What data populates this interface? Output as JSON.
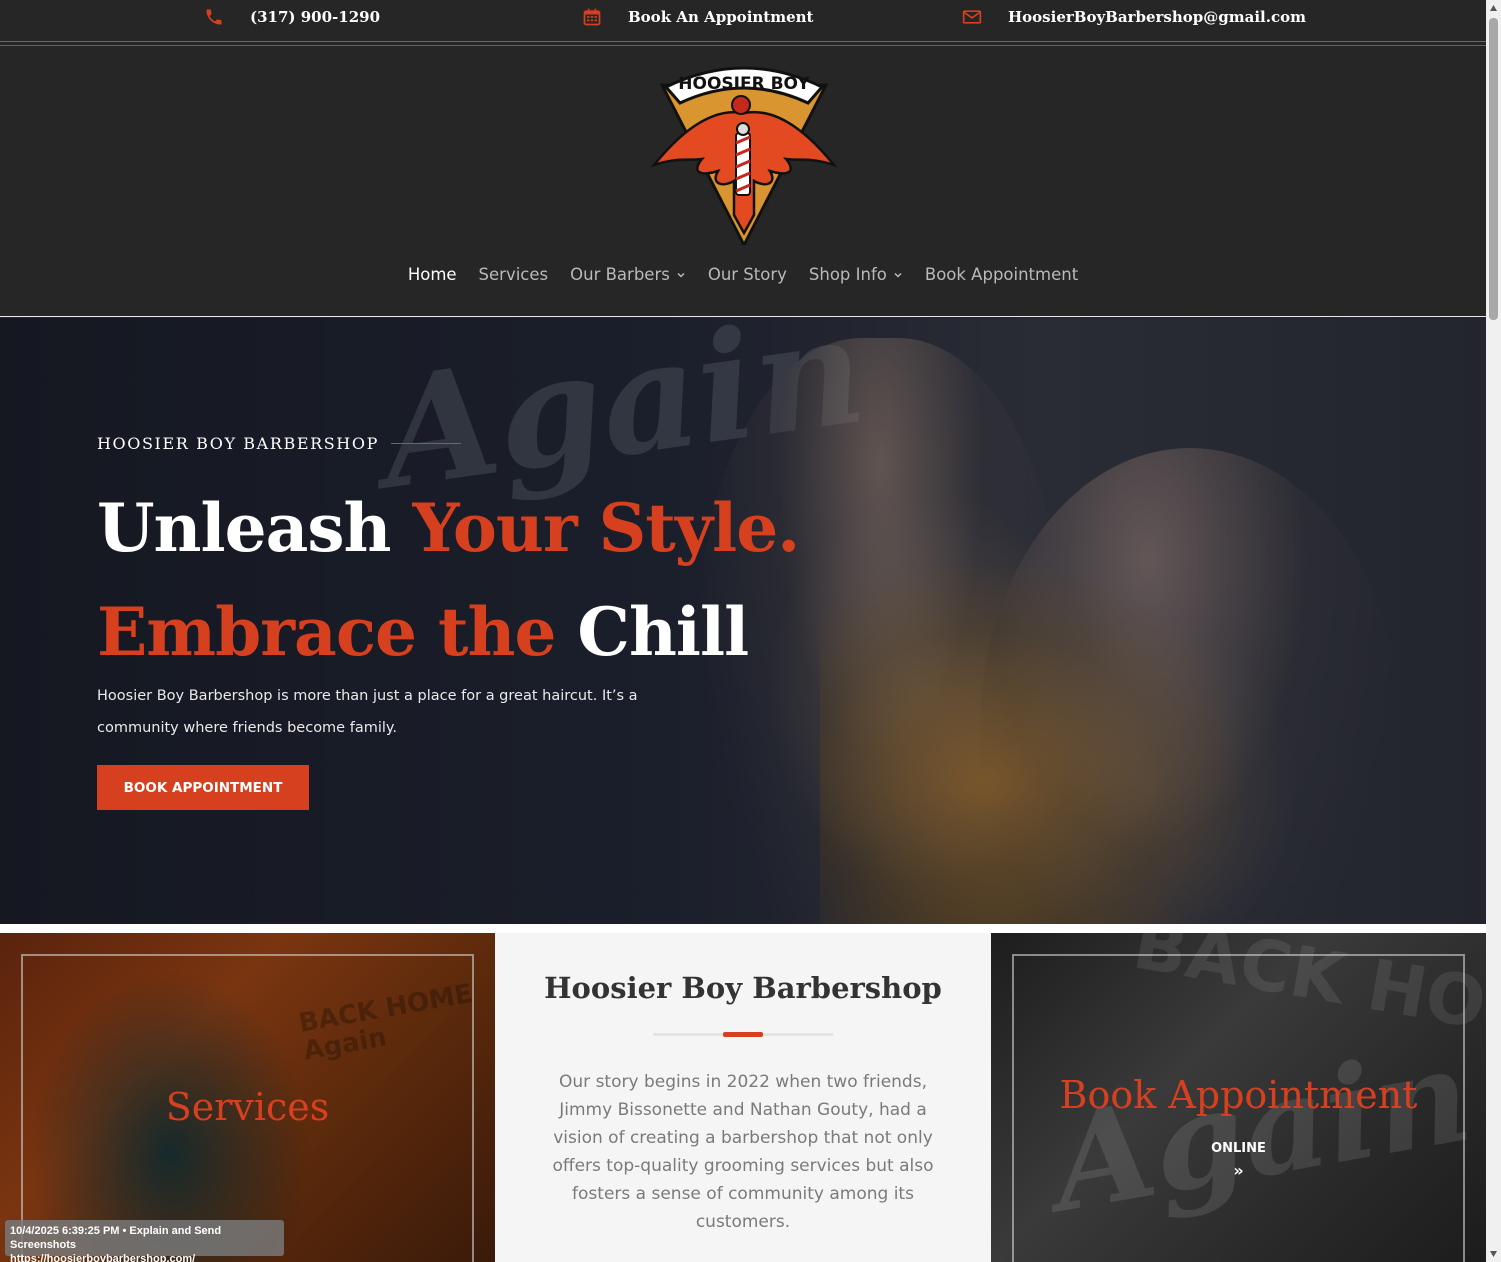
{
  "topbar": {
    "phone": "(317) 900-1290",
    "book": "Book An Appointment",
    "email": "HoosierBoyBarbershop@gmail.com",
    "icon_phone": "phone-icon",
    "icon_calendar": "calendar-icon",
    "icon_email": "envelope-icon"
  },
  "logo": {
    "text": "HOOSIER BOY"
  },
  "nav": {
    "items": [
      {
        "label": "Home",
        "active": true
      },
      {
        "label": "Services"
      },
      {
        "label": "Our Barbers",
        "dropdown": true
      },
      {
        "label": "Our Story"
      },
      {
        "label": "Shop Info",
        "dropdown": true
      },
      {
        "label": "Book Appointment"
      }
    ]
  },
  "hero": {
    "eyebrow": "HOOSIER BOY BARBERSHOP",
    "line1_white": "Unleash ",
    "line1_orange": "Your Style.",
    "line2_orange": "Embrace the ",
    "line2_white": "Chill",
    "paragraph": "Hoosier Boy Barbershop is more than just a place for a great haircut. It’s a community where friends become family.",
    "button": "BOOK APPOINTMENT",
    "bg_text": "Again"
  },
  "panels": {
    "left_title": "Services",
    "left_bg_text": "BACK HOME Again",
    "mid_title": "Hoosier Boy Barbershop",
    "mid_text": "Our story begins in 2022 when two friends, Jimmy Bissonette and Nathan Gouty, had a vision of creating a barbershop that not only offers top-quality grooming services but also fosters a sense of community among its customers.",
    "right_title": "Book Appointment",
    "right_sub": "ONLINE",
    "right_arrow": "»",
    "right_bg_text1": "BACK HOME",
    "right_bg_text2": "Again"
  },
  "status": {
    "line1": "10/4/2025 6:39:25 PM • Explain and Send Screenshots",
    "line2": "https://hoosierboybarbershop.com/"
  },
  "colors": {
    "accent": "#d7401e",
    "dark": "#262626"
  }
}
